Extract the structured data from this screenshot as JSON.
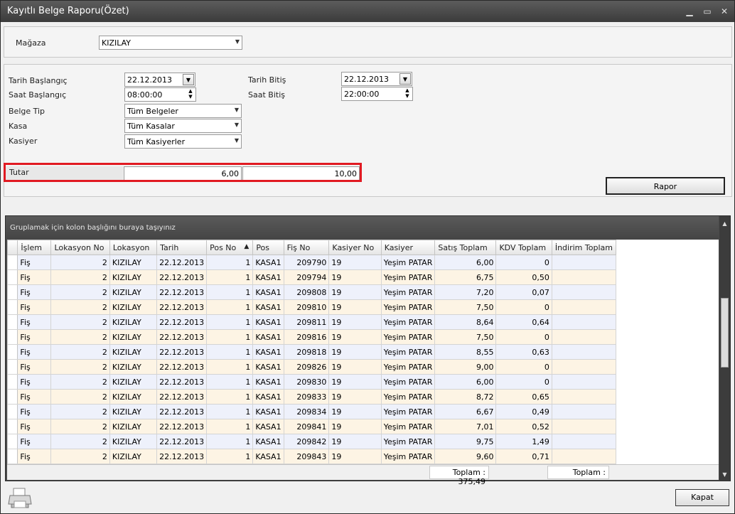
{
  "window": {
    "title": "Kayıtlı Belge Raporu(Özet)"
  },
  "store": {
    "label": "Mağaza",
    "value": "KIZILAY"
  },
  "filters": {
    "start_date_label": "Tarih Başlangıç",
    "start_date": "22.12.2013",
    "start_time_label": "Saat Başlangıç",
    "start_time": "08:00:00",
    "end_date_label": "Tarih Bitiş",
    "end_date": "22.12.2013",
    "end_time_label": "Saat Bitiş",
    "end_time": "22:00:00",
    "doc_type_label": "Belge Tip",
    "doc_type": "Tüm Belgeler",
    "register_label": "Kasa",
    "register": "Tüm Kasalar",
    "cashier_label": "Kasiyer",
    "cashier": "Tüm Kasiyerler",
    "amount_label": "Tutar",
    "amount_min": "6,00",
    "amount_max": "10,00"
  },
  "report_button": "Rapor",
  "grid": {
    "group_hint": "Gruplamak için kolon başlığını buraya taşıyınız",
    "columns": [
      "İşlem",
      "Lokasyon No",
      "Lokasyon",
      "Tarih",
      "Pos No",
      "Pos",
      "Fiş No",
      "Kasiyer No",
      "Kasiyer",
      "Satış Toplam",
      "KDV Toplam",
      "İndirim Toplam"
    ],
    "sort_indicator": "▲",
    "rows": [
      [
        "Fiş",
        "2",
        "KIZILAY",
        "22.12.2013",
        "1",
        "KASA1",
        "209790",
        "19",
        "Yeşim PATAR",
        "6,00",
        "0",
        ""
      ],
      [
        "Fiş",
        "2",
        "KIZILAY",
        "22.12.2013",
        "1",
        "KASA1",
        "209794",
        "19",
        "Yeşim PATAR",
        "6,75",
        "0,50",
        ""
      ],
      [
        "Fiş",
        "2",
        "KIZILAY",
        "22.12.2013",
        "1",
        "KASA1",
        "209808",
        "19",
        "Yeşim PATAR",
        "7,20",
        "0,07",
        ""
      ],
      [
        "Fiş",
        "2",
        "KIZILAY",
        "22.12.2013",
        "1",
        "KASA1",
        "209810",
        "19",
        "Yeşim PATAR",
        "7,50",
        "0",
        ""
      ],
      [
        "Fiş",
        "2",
        "KIZILAY",
        "22.12.2013",
        "1",
        "KASA1",
        "209811",
        "19",
        "Yeşim PATAR",
        "8,64",
        "0,64",
        ""
      ],
      [
        "Fiş",
        "2",
        "KIZILAY",
        "22.12.2013",
        "1",
        "KASA1",
        "209816",
        "19",
        "Yeşim PATAR",
        "7,50",
        "0",
        ""
      ],
      [
        "Fiş",
        "2",
        "KIZILAY",
        "22.12.2013",
        "1",
        "KASA1",
        "209818",
        "19",
        "Yeşim PATAR",
        "8,55",
        "0,63",
        ""
      ],
      [
        "Fiş",
        "2",
        "KIZILAY",
        "22.12.2013",
        "1",
        "KASA1",
        "209826",
        "19",
        "Yeşim PATAR",
        "9,00",
        "0",
        ""
      ],
      [
        "Fiş",
        "2",
        "KIZILAY",
        "22.12.2013",
        "1",
        "KASA1",
        "209830",
        "19",
        "Yeşim PATAR",
        "6,00",
        "0",
        ""
      ],
      [
        "Fiş",
        "2",
        "KIZILAY",
        "22.12.2013",
        "1",
        "KASA1",
        "209833",
        "19",
        "Yeşim PATAR",
        "8,72",
        "0,65",
        ""
      ],
      [
        "Fiş",
        "2",
        "KIZILAY",
        "22.12.2013",
        "1",
        "KASA1",
        "209834",
        "19",
        "Yeşim PATAR",
        "6,67",
        "0,49",
        ""
      ],
      [
        "Fiş",
        "2",
        "KIZILAY",
        "22.12.2013",
        "1",
        "KASA1",
        "209841",
        "19",
        "Yeşim PATAR",
        "7,01",
        "0,52",
        ""
      ],
      [
        "Fiş",
        "2",
        "KIZILAY",
        "22.12.2013",
        "1",
        "KASA1",
        "209842",
        "19",
        "Yeşim PATAR",
        "9,75",
        "1,49",
        ""
      ],
      [
        "Fiş",
        "2",
        "KIZILAY",
        "22.12.2013",
        "1",
        "KASA1",
        "209843",
        "19",
        "Yeşim PATAR",
        "9,60",
        "0,71",
        ""
      ]
    ],
    "footer_sales_total": "Toplam : 375,49",
    "footer_discount_total": "Toplam :"
  },
  "close_button": "Kapat",
  "icons": {
    "printer": "printer-icon"
  }
}
